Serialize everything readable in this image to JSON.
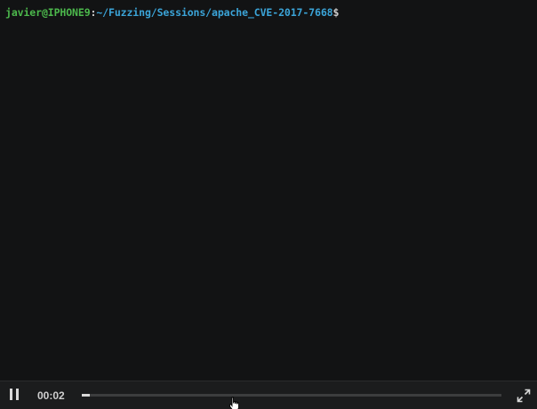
{
  "terminal": {
    "prompt": {
      "user_host": "javier@IPHONE9",
      "separator": ":",
      "path": "~/Fuzzing/Sessions/apache_CVE-2017-7668",
      "symbol": "$"
    }
  },
  "controls": {
    "time": "00:02",
    "progress": 0.02,
    "pause_icon": "pause-icon",
    "fullscreen_icon": "fullscreen-icon"
  },
  "colors": {
    "background": "#121314",
    "user_host": "#4cb84c",
    "path": "#3ba4d8",
    "control_bar": "#1b1c1d"
  }
}
